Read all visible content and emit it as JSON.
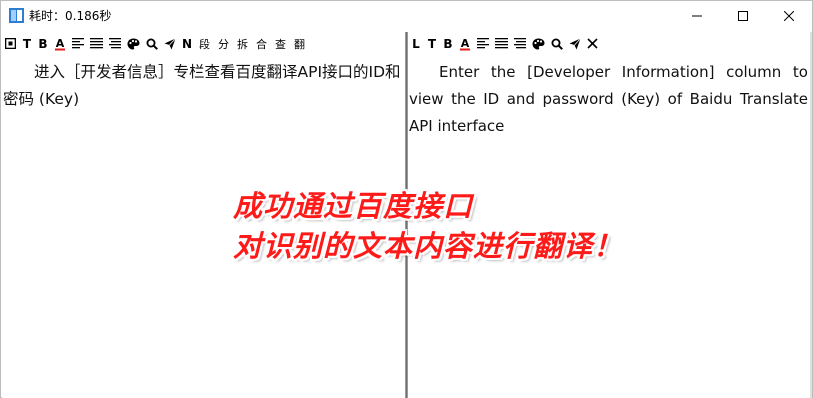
{
  "window": {
    "title": "耗时：0.186秒",
    "accent": "#2d7dd2"
  },
  "toolbar_left": {
    "items": [
      {
        "icon": "square-icon",
        "label": "",
        "name": "tb-left-box"
      },
      {
        "icon": "",
        "label": "T",
        "name": "tb-left-text"
      },
      {
        "icon": "",
        "label": "B",
        "name": "tb-left-bold"
      },
      {
        "icon": "font-color-icon",
        "label": "A",
        "name": "tb-left-font-color"
      },
      {
        "icon": "align-left-icon",
        "label": "",
        "name": "tb-left-align-left"
      },
      {
        "icon": "align-justify-icon",
        "label": "",
        "name": "tb-left-align-justify"
      },
      {
        "icon": "align-right-icon",
        "label": "",
        "name": "tb-left-align-right"
      },
      {
        "icon": "palette-icon",
        "label": "",
        "name": "tb-left-palette"
      },
      {
        "icon": "search-icon",
        "label": "",
        "name": "tb-left-search"
      },
      {
        "icon": "send-icon",
        "label": "",
        "name": "tb-left-send"
      },
      {
        "icon": "",
        "label": "N",
        "name": "tb-left-n"
      },
      {
        "icon": "",
        "label": "段",
        "name": "tb-left-paragraph"
      },
      {
        "icon": "",
        "label": "分",
        "name": "tb-left-split"
      },
      {
        "icon": "",
        "label": "拆",
        "name": "tb-left-break"
      },
      {
        "icon": "",
        "label": "合",
        "name": "tb-left-merge"
      },
      {
        "icon": "",
        "label": "查",
        "name": "tb-left-lookup"
      },
      {
        "icon": "",
        "label": "翻",
        "name": "tb-left-translate"
      }
    ]
  },
  "toolbar_right": {
    "items": [
      {
        "icon": "",
        "label": "L",
        "name": "tb-right-l"
      },
      {
        "icon": "",
        "label": "T",
        "name": "tb-right-text"
      },
      {
        "icon": "",
        "label": "B",
        "name": "tb-right-bold"
      },
      {
        "icon": "font-color-icon",
        "label": "A",
        "name": "tb-right-font-color"
      },
      {
        "icon": "align-left-icon",
        "label": "",
        "name": "tb-right-align-left"
      },
      {
        "icon": "align-justify-icon",
        "label": "",
        "name": "tb-right-align-justify"
      },
      {
        "icon": "align-right-icon",
        "label": "",
        "name": "tb-right-align-right"
      },
      {
        "icon": "palette-icon",
        "label": "",
        "name": "tb-right-palette"
      },
      {
        "icon": "search-icon",
        "label": "",
        "name": "tb-right-search"
      },
      {
        "icon": "send-icon",
        "label": "",
        "name": "tb-right-send"
      },
      {
        "icon": "close-icon",
        "label": "",
        "name": "tb-right-clear"
      }
    ]
  },
  "left_pane": {
    "text": "进入［开发者信息］专栏查看百度翻译API接口的ID和密码 (Key)"
  },
  "right_pane": {
    "text": "Enter the [Developer Information] column to view the ID and password (Key) of Baidu Translate API interface"
  },
  "caption": {
    "line1": "成功通过百度接口",
    "line2": "对识别的文本内容进行翻译！",
    "color": "#ff1a1a"
  }
}
